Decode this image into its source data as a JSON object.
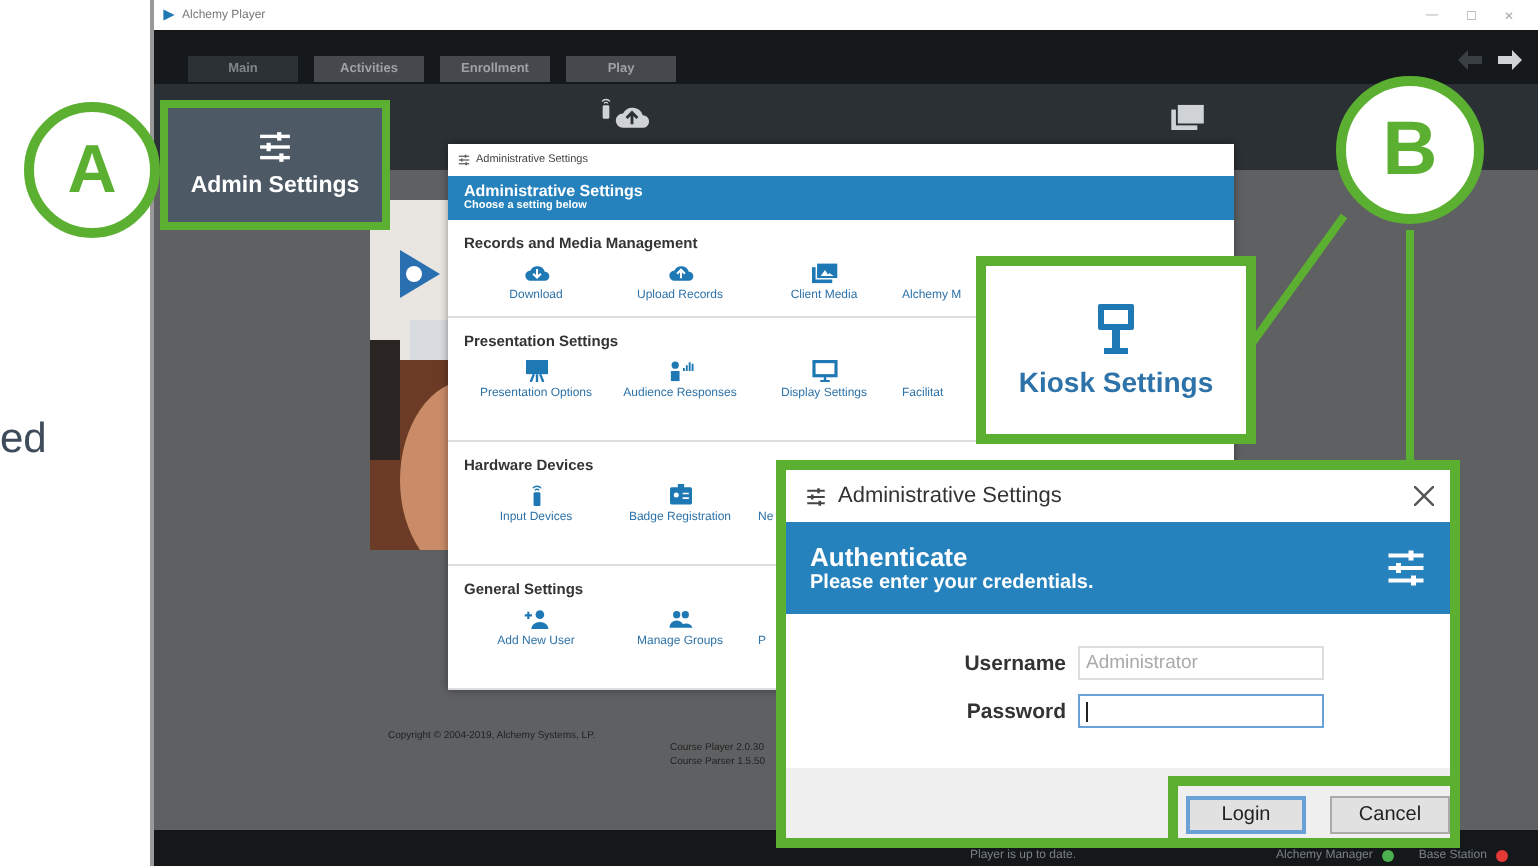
{
  "page_text": "ed",
  "window": {
    "title": "Alchemy Player",
    "controls": [
      "—",
      "☐",
      "✕"
    ]
  },
  "tabs": [
    {
      "label": "Main",
      "selected": true
    },
    {
      "label": "Activities",
      "selected": false
    },
    {
      "label": "Enrollment",
      "selected": false
    },
    {
      "label": "Play",
      "selected": false
    }
  ],
  "about": {
    "copyright": "Copyright © 2004-2019, Alchemy Systems, LP.",
    "versions": [
      "Course Player 2.0.30",
      "Course Parser 1.5.50"
    ]
  },
  "status_bar": {
    "message": "Player is up to date.",
    "items": [
      {
        "label": "Alchemy Manager",
        "color": "#4caf50"
      },
      {
        "label": "Base Station",
        "color": "#e53935"
      }
    ]
  },
  "admin_dialog": {
    "title": "Administrative Settings",
    "heading": "Administrative Settings",
    "subheading": "Choose a setting below",
    "sections": [
      {
        "title": "Records and Media Management",
        "items": [
          {
            "label": "Download",
            "kind": "download"
          },
          {
            "label": "Upload Records",
            "kind": "upload"
          },
          {
            "label": "Client Media",
            "kind": "media"
          },
          {
            "label": "Alchemy M",
            "kind": "none"
          }
        ]
      },
      {
        "title": "Presentation Settings",
        "items": [
          {
            "label": "Presentation Options",
            "kind": "presentation"
          },
          {
            "label": "Audience Responses",
            "kind": "audience"
          },
          {
            "label": "Display Settings",
            "kind": "display"
          },
          {
            "label": "Facilitat",
            "kind": "none"
          }
        ]
      },
      {
        "title": "Hardware Devices",
        "items": [
          {
            "label": "Input Devices",
            "kind": "remote"
          },
          {
            "label": "Badge Registration",
            "kind": "badge"
          },
          {
            "label": "Ne",
            "kind": "none"
          }
        ]
      },
      {
        "title": "General Settings",
        "items": [
          {
            "label": "Add New User",
            "kind": "adduser"
          },
          {
            "label": "Manage Groups",
            "kind": "groups"
          },
          {
            "label": "P",
            "kind": "none"
          }
        ]
      }
    ]
  },
  "callouts": [
    {
      "letter": "A"
    },
    {
      "letter": "B"
    }
  ],
  "admin_button": {
    "label": "Admin Settings"
  },
  "kiosk": {
    "label": "Kiosk Settings"
  },
  "auth_dialog": {
    "title": "Administrative Settings",
    "heading": "Authenticate",
    "subheading": "Please enter your credentials.",
    "fields": [
      {
        "label": "Username",
        "value": "Administrator",
        "disabled": true,
        "focused": false
      },
      {
        "label": "Password",
        "disabled": false,
        "focused": true
      }
    ],
    "buttons": [
      {
        "label": "Login",
        "default": true
      },
      {
        "label": "Cancel",
        "default": false
      }
    ]
  }
}
